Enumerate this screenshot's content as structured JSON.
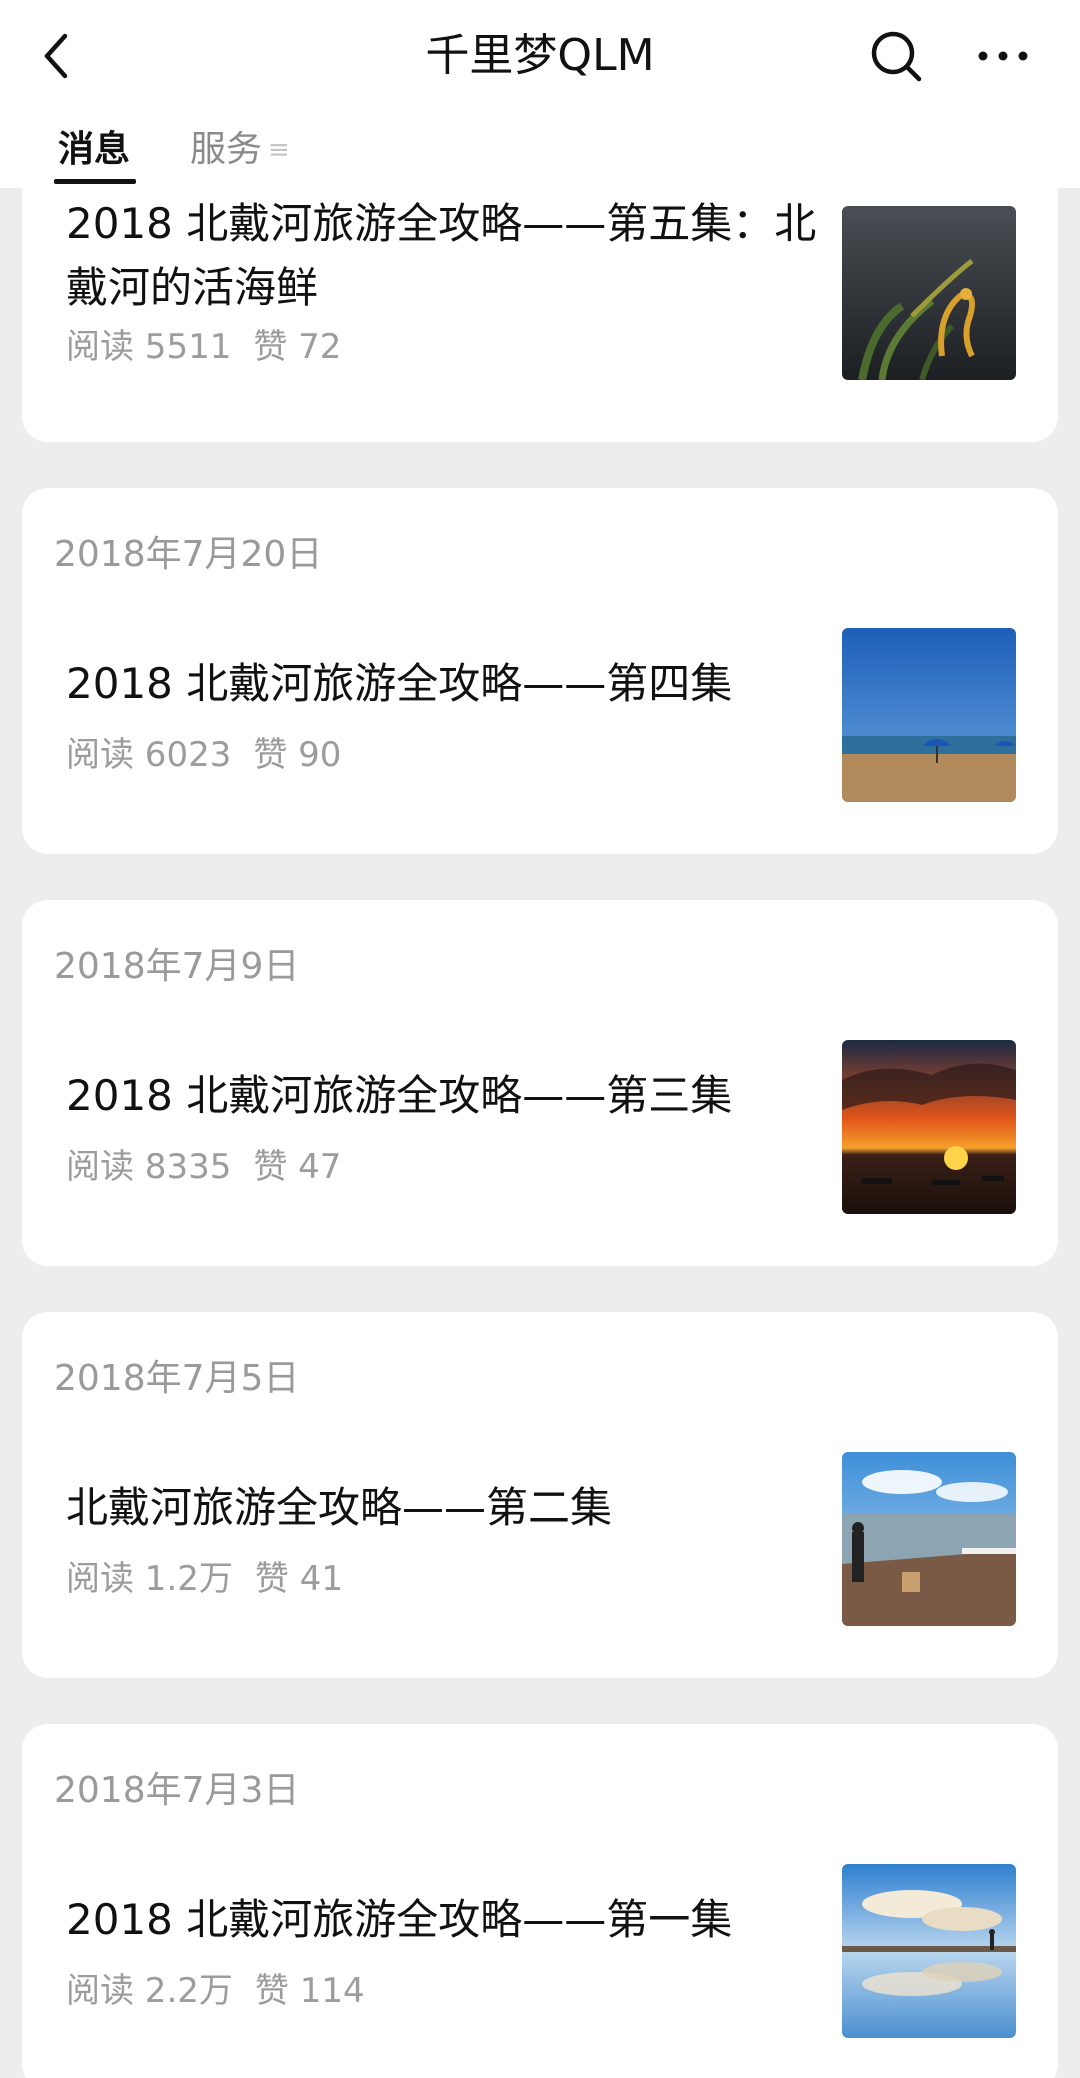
{
  "header": {
    "title": "千里梦QLM",
    "back_icon": "chevron-left-icon",
    "search_icon": "search-icon",
    "more_icon": "more-dots-icon"
  },
  "tabs": [
    {
      "label": "消息",
      "active": true
    },
    {
      "label": "服务",
      "menu_icon": "≡"
    }
  ],
  "articles": [
    {
      "date": "",
      "title": "2018 北戴河旅游全攻略——第五集：北戴河的活海鲜",
      "reads": "阅读 5511",
      "likes": "赞 72",
      "thumbnail": "seahorse-photo"
    },
    {
      "date": "2018年7月20日",
      "title": "2018 北戴河旅游全攻略——第四集",
      "reads": "阅读 6023",
      "likes": "赞 90",
      "thumbnail": "beach-umbrellas-photo"
    },
    {
      "date": "2018年7月9日",
      "title": "2018 北戴河旅游全攻略——第三集",
      "reads": "阅读 8335",
      "likes": "赞 47",
      "thumbnail": "sunset-boats-photo"
    },
    {
      "date": "2018年7月5日",
      "title": "北戴河旅游全攻略——第二集",
      "reads": "阅读 1.2万",
      "likes": "赞 41",
      "thumbnail": "pier-people-photo"
    },
    {
      "date": "2018年7月3日",
      "title": "2018 北戴河旅游全攻略——第一集",
      "reads": "阅读 2.2万",
      "likes": "赞 114",
      "thumbnail": "reflection-beach-photo"
    }
  ],
  "colors": {
    "background": "#ededed",
    "card": "#ffffff",
    "text_primary": "#111111",
    "text_secondary": "#9c9c9c"
  }
}
